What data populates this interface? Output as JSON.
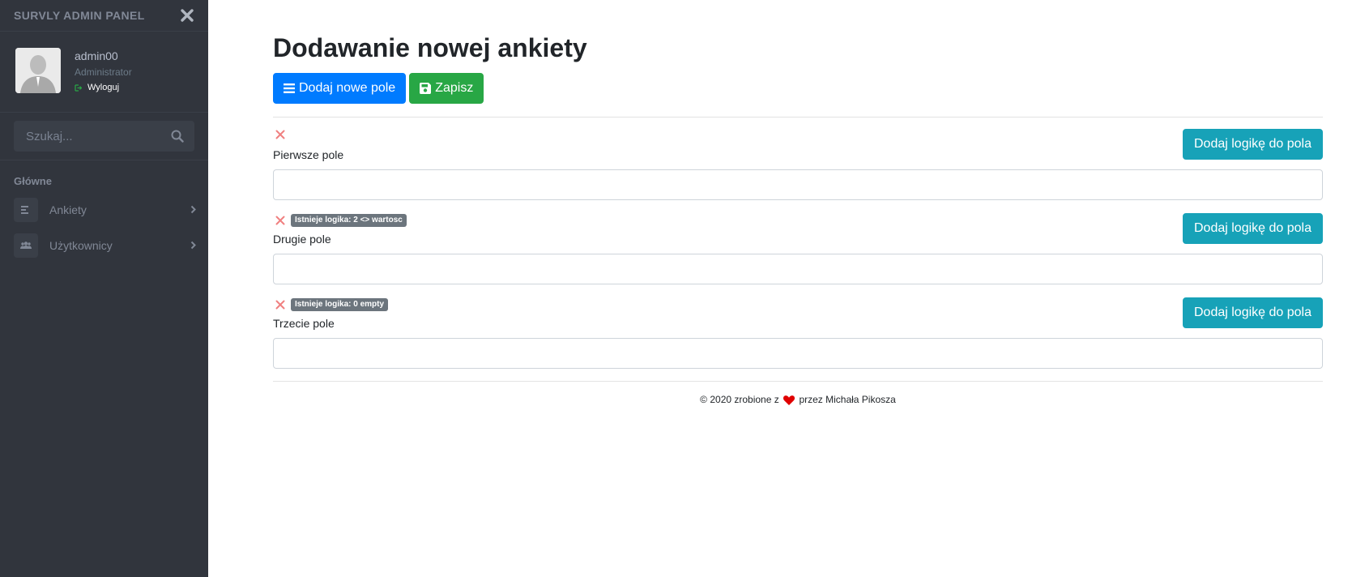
{
  "sidebar": {
    "brand": "SURVLY ADMIN PANEL",
    "user": {
      "name": "admin00",
      "role": "Administrator",
      "logout": "Wyloguj"
    },
    "search": {
      "placeholder": "Szukaj..."
    },
    "section_title": "Główne",
    "items": [
      {
        "label": "Ankiety",
        "icon": "list-icon"
      },
      {
        "label": "Użytkownicy",
        "icon": "users-icon"
      }
    ]
  },
  "main": {
    "title": "Dodawanie nowej ankiety",
    "add_field_label": "Dodaj nowe pole",
    "save_label": "Zapisz",
    "fields": [
      {
        "label": "Pierwsze pole",
        "logic_badge": "",
        "logic_button": "Dodaj logikę do pola",
        "value": ""
      },
      {
        "label": "Drugie pole",
        "logic_badge": "Istnieje logika: 2 <> wartosc",
        "logic_button": "Dodaj logikę do pola",
        "value": ""
      },
      {
        "label": "Trzecie pole",
        "logic_badge": "Istnieje logika: 0 empty",
        "logic_button": "Dodaj logikę do pola",
        "value": ""
      }
    ]
  },
  "footer": {
    "before": "© 2020 zrobione z",
    "after": "przez Michała Pikosza"
  },
  "colors": {
    "sidebar_bg": "#31353d",
    "primary": "#007bff",
    "success": "#28a745",
    "info": "#17a2b8",
    "danger_icon": "#f08080",
    "badge": "#6c757d",
    "heart": "#e00000"
  }
}
